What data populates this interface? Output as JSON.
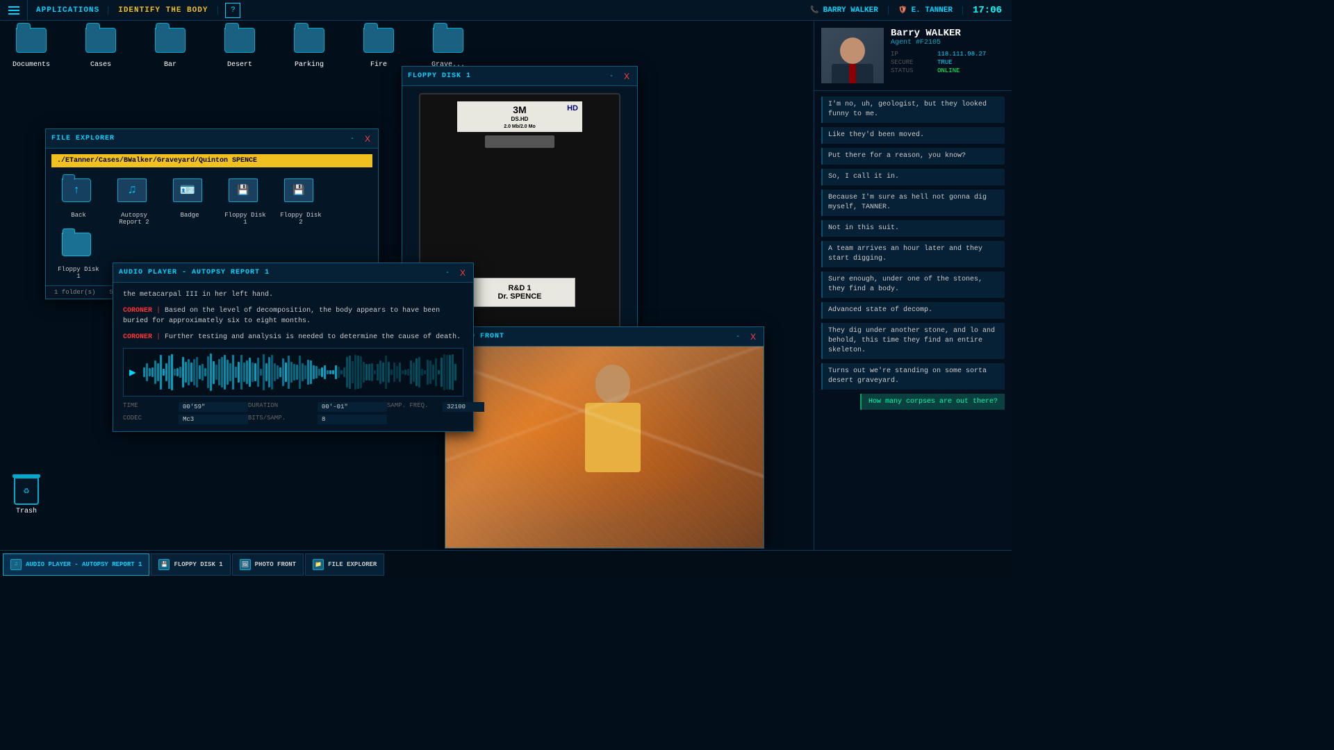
{
  "topMenu": {
    "hamburger_label": "☰",
    "app_label": "APPLICATIONS",
    "task_label": "IDENTIFY THE BODY",
    "help_label": "?",
    "agent_name": "BARRY WALKER",
    "user_name": "E. TANNER",
    "time": "17:06"
  },
  "desktop": {
    "icons": [
      {
        "label": "Documents",
        "type": "folder"
      },
      {
        "label": "Cases",
        "type": "folder"
      },
      {
        "label": "Bar",
        "type": "folder"
      },
      {
        "label": "Desert",
        "type": "folder"
      },
      {
        "label": "Parking",
        "type": "folder"
      },
      {
        "label": "Fire",
        "type": "folder"
      },
      {
        "label": "Grave...",
        "type": "folder"
      }
    ],
    "trash_label": "Trash"
  },
  "fileExplorer": {
    "title": "FILE EXPLORER",
    "minimize_label": "-",
    "close_label": "X",
    "path": "./ETanner/Cases/BWalker/Graveyard/Quinton SPENCE",
    "files": [
      {
        "label": "Back",
        "type": "back"
      },
      {
        "label": "Autopsy Report 2",
        "type": "audio"
      },
      {
        "label": "Badge",
        "type": "image"
      },
      {
        "label": "Floppy Disk 1",
        "type": "floppy"
      },
      {
        "label": "Floppy Disk 2",
        "type": "floppy"
      },
      {
        "label": "Floppy Disk 1",
        "type": "folder"
      }
    ],
    "status_folders": "1 folder(s)",
    "status_files": "5 file(s)"
  },
  "floppyDisk": {
    "title": "FLOPPY DISK 1",
    "minimize_label": "-",
    "close_label": "X",
    "brand": "3M",
    "model": "DS.HD",
    "capacity": "2.0 Mb/2.0 Mo",
    "hd_label": "HD",
    "label_line1": "R&D 1",
    "label_line2": "Dr. SPENCE"
  },
  "audioPlayer": {
    "title": "AUDIO PLAYER - AUTOPSY REPORT 1",
    "minimize_label": "-",
    "close_label": "X",
    "text_intro": "the metacarpal III in her left hand.",
    "coroner_label1": "CORONER",
    "text_body1": "Based on the level of decomposition, the body appears to have been buried for approximately six to eight months.",
    "coroner_label2": "CORONER",
    "text_body2": "Further testing and analysis is needed to determine the cause of death.",
    "time_key": "TIME",
    "time_val": "00'59\"",
    "duration_key": "DURATION",
    "duration_val": "00'-01\"",
    "samp_freq_key": "SAMP. FREQ.",
    "samp_freq_val": "32100",
    "codec_key": "CODEC",
    "codec_val": "Mc3",
    "bits_key": "BITS/SAMP.",
    "bits_val": "8"
  },
  "photo": {
    "title": "PHOTO FRONT",
    "minimize_label": "-",
    "close_label": "X"
  },
  "sidebar": {
    "agent_name": "Barry WALKER",
    "agent_id": "Agent #F2105",
    "ip_key": "IP",
    "ip_val": "118.111.98.27",
    "secure_key": "SECURE",
    "secure_val": "TRUE",
    "status_key": "STATUS",
    "status_val": "ONLINE",
    "messages": [
      "I'm no, uh, geologist, but they looked funny to me.",
      "Like they'd been moved.",
      "Put there for a reason, you know?",
      "So, I call it in.",
      "Because I'm sure as hell not gonna dig myself, TANNER.",
      "Not in this suit.",
      "A team arrives an hour later and they start digging.",
      "Sure enough, under one of the stones, they find a body.",
      "Advanced state of decomp.",
      "They dig under another stone, and lo and behold, this time they find an entire skeleton.",
      "Turns out we're standing on some sorta desert graveyard."
    ],
    "question": "How many corpses are out there?"
  },
  "taskbar": {
    "items": [
      {
        "label": "AUDIO PLAYER - AUTOPSY REPORT 1",
        "active": true,
        "icon": "audio"
      },
      {
        "label": "FLOPPY DISK 1",
        "active": false,
        "icon": "floppy"
      },
      {
        "label": "PHOTO FRONT",
        "active": false,
        "icon": "photo"
      },
      {
        "label": "FILE EXPLORER",
        "active": false,
        "icon": "folder"
      }
    ]
  }
}
